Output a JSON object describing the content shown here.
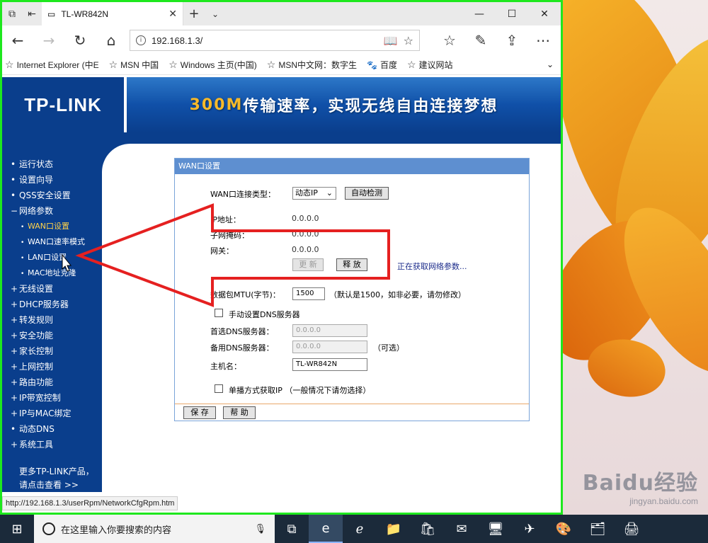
{
  "browser": {
    "tab_title": "TL-WR842N",
    "url": "192.168.1.3/",
    "status_url": "http://192.168.1.3/userRpm/NetworkCfgRpm.htm"
  },
  "favorites": [
    "Internet Explorer (中E",
    "MSN 中国",
    "Windows 主页(中国)",
    "MSN中文网：数字生",
    "百度",
    "建议网站"
  ],
  "banner": {
    "logo": "TP-LINK",
    "slogan_highlight": "300M",
    "slogan_rest": "传输速率，实现无线自由连接梦想"
  },
  "sidebar": {
    "items": [
      "运行状态",
      "设置向导",
      "QSS安全设置",
      "网络参数",
      "WAN口设置",
      "WAN口速率模式",
      "LAN口设置",
      "MAC地址克隆",
      "无线设置",
      "DHCP服务器",
      "转发规则",
      "安全功能",
      "家长控制",
      "上网控制",
      "路由功能",
      "IP带宽控制",
      "IP与MAC绑定",
      "动态DNS",
      "系统工具"
    ],
    "more_line1": "更多TP-LINK产品，",
    "more_line2": "请点击查看 >>"
  },
  "wan": {
    "title": "WAN口设置",
    "conn_type_label": "WAN口连接类型：",
    "conn_type_value": "动态IP",
    "auto_detect": "自动检测",
    "ip_label": "IP地址：",
    "ip_value": "0.0.0.0",
    "mask_label": "子网掩码：",
    "mask_value": "0.0.0.0",
    "gw_label": "网关：",
    "gw_value": "0.0.0.0",
    "renew": "更 新",
    "release": "释 放",
    "status_msg": "正在获取网络参数...",
    "mtu_label": "数据包MTU(字节)：",
    "mtu_value": "1500",
    "mtu_hint": "（默认是1500，如非必要，请勿修改）",
    "manual_dns": "手动设置DNS服务器",
    "dns1_label": "首选DNS服务器：",
    "dns1_value": "0.0.0.0",
    "dns2_label": "备用DNS服务器：",
    "dns2_value": "0.0.0.0",
    "optional": "（可选）",
    "host_label": "主机名：",
    "host_value": "TL-WR842N",
    "unicast": "单播方式获取IP （一般情况下请勿选择）",
    "save": "保 存",
    "help": "帮 助"
  },
  "taskbar": {
    "search_placeholder": "在这里输入你要搜索的内容"
  },
  "watermark": {
    "brand": "Baidu经验",
    "url": "jingyan.baidu.com"
  },
  "colors": {
    "router_blue": "#0a3e8c",
    "annotation_red": "#e52020",
    "window_highlight": "#1ee81e"
  }
}
